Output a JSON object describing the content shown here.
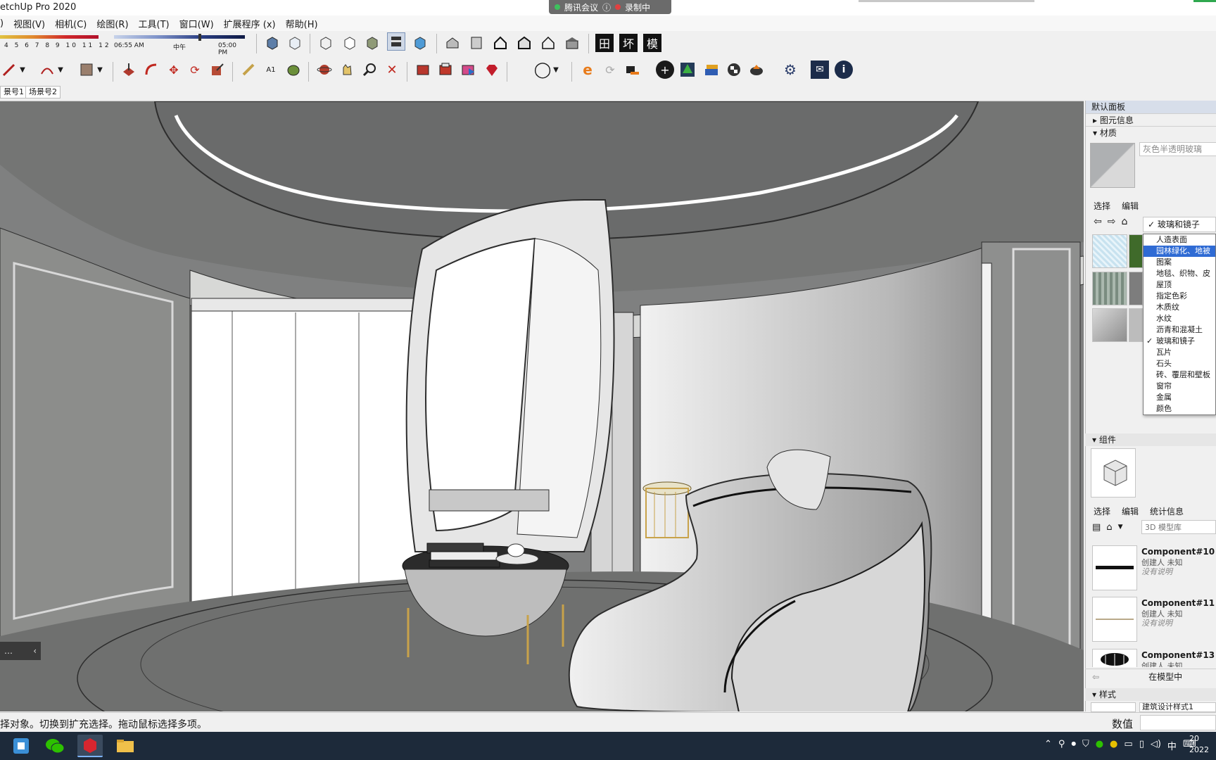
{
  "app": {
    "title": "etchUp Pro 2020"
  },
  "meeting": {
    "label": "腾讯会议",
    "info": "ⓘ",
    "rec": "录制中"
  },
  "menu": [
    "视图(V)",
    "相机(C)",
    "绘图(R)",
    "工具(T)",
    "窗口(W)",
    "扩展程序 (x)",
    "帮助(H)"
  ],
  "menu_lead": ")",
  "shadow": {
    "months": "4 5 6 7 8 9 10 11 12",
    "start": "06:55 AM",
    "noon": "中午",
    "end": "05:00 PM"
  },
  "scene_tabs": [
    "景号1",
    "场景号2"
  ],
  "panel": {
    "title": "默认面板",
    "entity_info": "图元信息",
    "materials": "材质",
    "material_name": "灰色半透明玻璃",
    "tab_select": "选择",
    "tab_edit": "编辑",
    "current_category": "✓ 玻璃和镜子",
    "categories": [
      {
        "label": "人造表面",
        "selected": false,
        "checked": false
      },
      {
        "label": "园林绿化、地被",
        "selected": true,
        "checked": false
      },
      {
        "label": "图案",
        "selected": false,
        "checked": false
      },
      {
        "label": "地毯、织物、皮",
        "selected": false,
        "checked": false
      },
      {
        "label": "屋顶",
        "selected": false,
        "checked": false
      },
      {
        "label": "指定色彩",
        "selected": false,
        "checked": false
      },
      {
        "label": "木质纹",
        "selected": false,
        "checked": false
      },
      {
        "label": "水纹",
        "selected": false,
        "checked": false
      },
      {
        "label": "沥青和混凝土",
        "selected": false,
        "checked": false
      },
      {
        "label": "玻璃和镜子",
        "selected": false,
        "checked": true
      },
      {
        "label": "瓦片",
        "selected": false,
        "checked": false
      },
      {
        "label": "石头",
        "selected": false,
        "checked": false
      },
      {
        "label": "砖、覆层和壁板",
        "selected": false,
        "checked": false
      },
      {
        "label": "窗帘",
        "selected": false,
        "checked": false
      },
      {
        "label": "金属",
        "selected": false,
        "checked": false
      },
      {
        "label": "颜色",
        "selected": false,
        "checked": false
      }
    ],
    "components": "组件",
    "tab_stats": "统计信息",
    "search_placeholder": "3D 模型库",
    "component_items": [
      {
        "name": "Component#10",
        "by": "创建人 未知",
        "desc": "没有说明"
      },
      {
        "name": "Component#11",
        "by": "创建人 未知",
        "desc": "没有说明"
      },
      {
        "name": "Component#13",
        "by": "创建人 未知",
        "desc": ""
      }
    ],
    "in_model": "在模型中",
    "styles": "样式",
    "style_name": "建筑设计样式1"
  },
  "status": {
    "message": "择对象。切换到扩充选择。拖动鼠标选择多项。",
    "value_label": "数值"
  },
  "taskbar": {
    "ime": "中",
    "clock_top": "20",
    "clock_bottom": "2022"
  },
  "colors": {
    "accent": "#2f6bd4",
    "panel_header": "#d7deea",
    "viewport_bg": "#8b8b89",
    "taskbar": "#1d2a3a"
  }
}
